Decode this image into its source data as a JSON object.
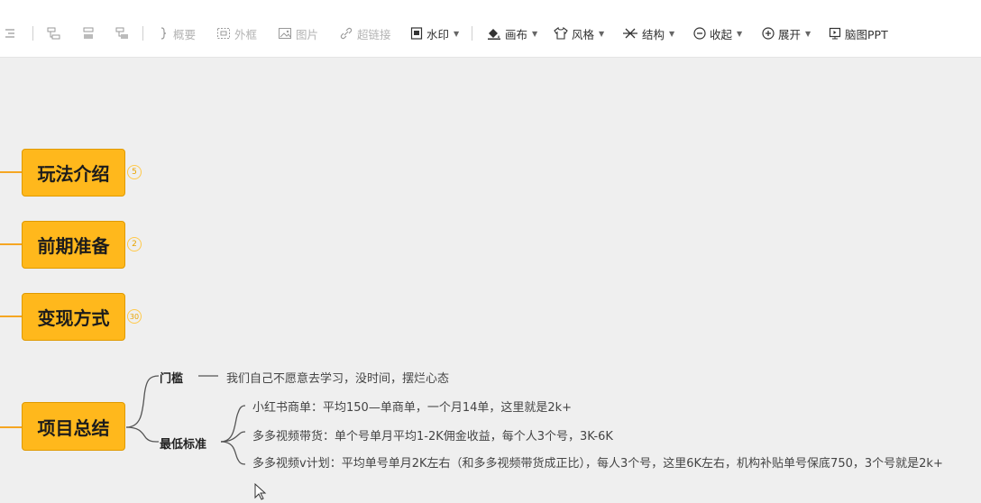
{
  "toolbar": {
    "summary_label": "概要",
    "boundary_label": "外框",
    "image_label": "图片",
    "hyperlink_label": "超链接",
    "watermark_label": "水印",
    "canvas_label": "画布",
    "style_label": "风格",
    "structure_label": "结构",
    "collapse_label": "收起",
    "expand_label": "展开",
    "mindmap_ppt_label": "脑图PPT"
  },
  "mindmap": {
    "nodes": [
      {
        "label": "玩法介绍",
        "count": "5"
      },
      {
        "label": "前期准备",
        "count": "2"
      },
      {
        "label": "变现方式",
        "count": "30"
      },
      {
        "label": "项目总结"
      }
    ],
    "summary": {
      "threshold_label": "门槛",
      "threshold_text": "我们自己不愿意去学习，没时间，摆烂心态",
      "standard_label": "最低标准",
      "standard_items": [
        "小红书商单：平均150—单商单，一个月14单，这里就是2k+",
        "多多视频带货：单个号单月平均1-2K佣金收益，每个人3个号，3K-6K",
        "多多视频v计划：平均单号单月2K左右（和多多视频带货成正比），每人3个号，这里6K左右，机构补贴单号保底750，3个号就是2k+"
      ]
    }
  },
  "colors": {
    "node_fill": "#ffb81c",
    "connector": "#f5a623"
  }
}
